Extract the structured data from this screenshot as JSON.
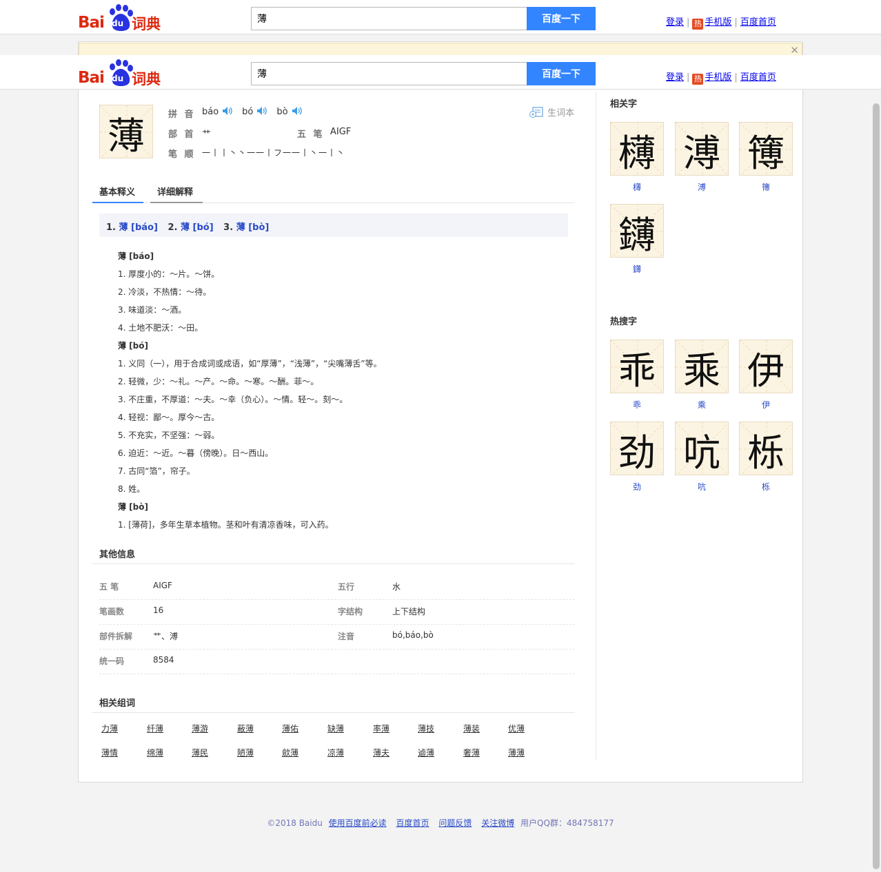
{
  "header": {
    "logo_bai": "Bai",
    "logo_du": "du",
    "logo_cidian": "词典",
    "search_value": "薄",
    "search_button": "百度一下",
    "login": "登录",
    "hot_badge": "热",
    "mobile": "手机版",
    "home": "百度首页"
  },
  "notice": {
    "close": "✕"
  },
  "entry": {
    "char": "薄",
    "pinyin_label": "拼 音",
    "pinyin": [
      "báo",
      "bó",
      "bò"
    ],
    "bushou_label": "部 首",
    "bushou": "艹",
    "wubi_label": "五 笔",
    "wubi": "AIGF",
    "bishun_label": "笔 顺",
    "bishun": "一丨丨丶丶一一丨フ一一丨丶一丨丶",
    "vocab_button": "生词本"
  },
  "tabs": [
    "基本释义",
    "详细解释"
  ],
  "navbar": [
    {
      "num": "1.",
      "label": "薄 [báo]"
    },
    {
      "num": "2.",
      "label": "薄 [bó]"
    },
    {
      "num": "3.",
      "label": "薄 [bò]"
    }
  ],
  "definitions": [
    {
      "head": "薄 [báo]",
      "items": [
        "1. 厚度小的：～片。～饼。",
        "2. 冷淡，不热情：～待。",
        "3. 味道淡：～酒。",
        "4. 土地不肥沃：～田。"
      ]
    },
    {
      "head": "薄 [bó]",
      "items": [
        "1. 义同（一），用于合成词或成语，如“厚薄”，“浅薄”，“尖嘴薄舌”等。",
        "2. 轻微，少：～礼。～产。～命。～寒。～酬。菲～。",
        "3. 不庄重，不厚道：～夫。～幸（负心）。～情。轻～。刻～。",
        "4. 轻视：鄙～。厚今～古。",
        "5. 不充实，不坚强：～弱。",
        "6. 迫近：～近。～暮（傍晚）。日～西山。",
        "7. 古同“箔”，帘子。",
        "8. 姓。"
      ]
    },
    {
      "head": "薄 [bò]",
      "items": [
        "1. [薄荷]，多年生草本植物。茎和叶有清凉香味，可入药。"
      ]
    }
  ],
  "other_info": {
    "title": "其他信息",
    "rows": [
      [
        {
          "k": "五 笔",
          "v": "AIGF"
        },
        {
          "k": "五行",
          "v": "水"
        }
      ],
      [
        {
          "k": "笔画数",
          "v": "16"
        },
        {
          "k": "字结构",
          "v": "上下结构"
        }
      ],
      [
        {
          "k": "部件拆解",
          "v": "艹、溥"
        },
        {
          "k": "注音",
          "v": "bó,báo,bò"
        }
      ],
      [
        {
          "k": "统一码",
          "v": "8584"
        }
      ]
    ]
  },
  "related_words": {
    "title": "相关组词",
    "row1": [
      "力薄",
      "纤薄",
      "薄游",
      "蔽薄",
      "薄佑",
      "缺薄",
      "率薄",
      "薄技",
      "薄装",
      "优薄"
    ],
    "row2": [
      "薄情",
      "绵薄",
      "薄民",
      "陋薄",
      "歛薄",
      "凉薄",
      "薄夫",
      "逌薄",
      "奢薄",
      "薄薄"
    ]
  },
  "sidebar": {
    "related_title": "相关字",
    "related": [
      "欂",
      "溥",
      "簙",
      "鑮"
    ],
    "hot_title": "热搜字",
    "hot": [
      "乖",
      "乘",
      "伊",
      "劲",
      "吭",
      "栎"
    ]
  },
  "footer": {
    "copyright": "©2018 Baidu",
    "links": [
      "使用百度前必读",
      "百度首页",
      "问题反馈",
      "关注微博"
    ],
    "qq": "用户QQ群：484758177"
  },
  "colors": {
    "accent": "#3385ff",
    "logo_red": "#de2910",
    "link_blue": "#2a4bc8"
  }
}
